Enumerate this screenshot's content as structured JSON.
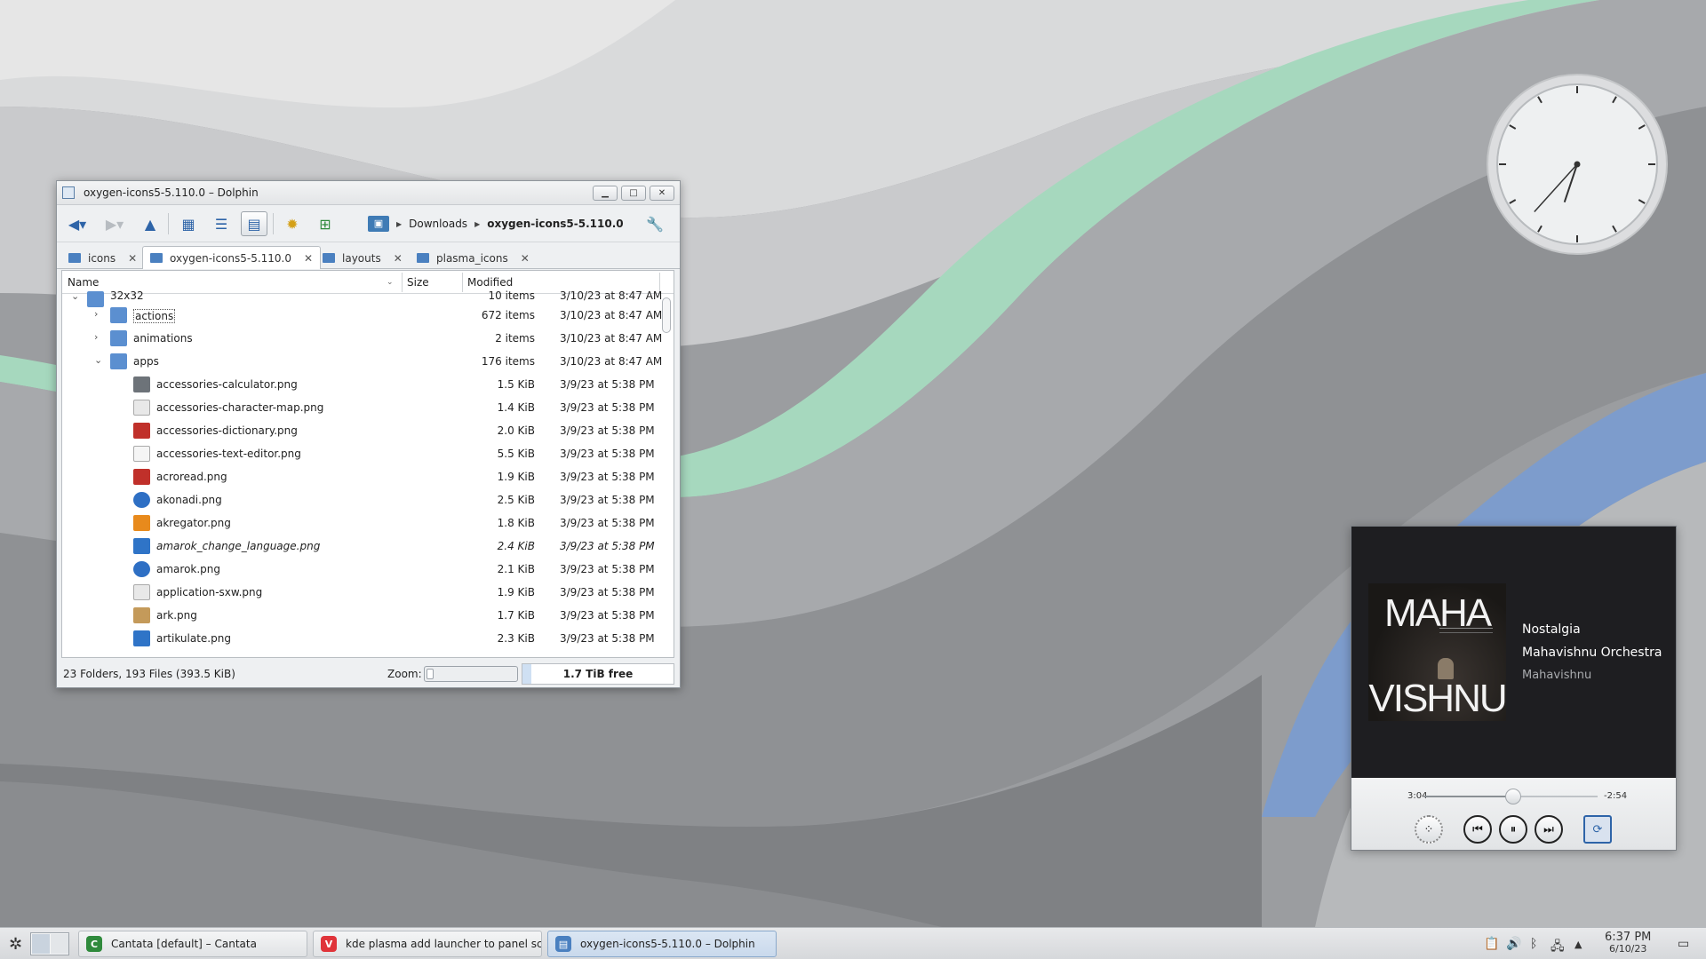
{
  "dolphin": {
    "title": "oxygen-icons5-5.110.0 – Dolphin",
    "breadcrumb": {
      "parent": "Downloads",
      "current": "oxygen-icons5-5.110.0"
    },
    "tabs": [
      {
        "label": "icons",
        "active": false
      },
      {
        "label": "oxygen-icons5-5.110.0",
        "active": true
      },
      {
        "label": "layouts",
        "active": false
      },
      {
        "label": "plasma_icons",
        "active": false
      }
    ],
    "columns": {
      "name": "Name",
      "size": "Size",
      "modified": "Modified"
    },
    "rows": [
      {
        "name": "32x32",
        "size": "10 items",
        "modified": "3/10/23 at 8:47 AM"
      },
      {
        "name": "actions",
        "size": "672 items",
        "modified": "3/10/23 at 8:47 AM"
      },
      {
        "name": "animations",
        "size": "2 items",
        "modified": "3/10/23 at 8:47 AM"
      },
      {
        "name": "apps",
        "size": "176 items",
        "modified": "3/10/23 at 8:47 AM"
      },
      {
        "name": "accessories-calculator.png",
        "size": "1.5 KiB",
        "modified": "3/9/23 at 5:38 PM"
      },
      {
        "name": "accessories-character-map.png",
        "size": "1.4 KiB",
        "modified": "3/9/23 at 5:38 PM"
      },
      {
        "name": "accessories-dictionary.png",
        "size": "2.0 KiB",
        "modified": "3/9/23 at 5:38 PM"
      },
      {
        "name": "accessories-text-editor.png",
        "size": "5.5 KiB",
        "modified": "3/9/23 at 5:38 PM"
      },
      {
        "name": "acroread.png",
        "size": "1.9 KiB",
        "modified": "3/9/23 at 5:38 PM"
      },
      {
        "name": "akonadi.png",
        "size": "2.5 KiB",
        "modified": "3/9/23 at 5:38 PM"
      },
      {
        "name": "akregator.png",
        "size": "1.8 KiB",
        "modified": "3/9/23 at 5:38 PM"
      },
      {
        "name": "amarok_change_language.png",
        "size": "2.4 KiB",
        "modified": "3/9/23 at 5:38 PM"
      },
      {
        "name": "amarok.png",
        "size": "2.1 KiB",
        "modified": "3/9/23 at 5:38 PM"
      },
      {
        "name": "application-sxw.png",
        "size": "1.9 KiB",
        "modified": "3/9/23 at 5:38 PM"
      },
      {
        "name": "ark.png",
        "size": "1.7 KiB",
        "modified": "3/9/23 at 5:38 PM"
      },
      {
        "name": "artikulate.png",
        "size": "2.3 KiB",
        "modified": "3/9/23 at 5:38 PM"
      }
    ],
    "status": {
      "info": "23 Folders, 193 Files (393.5 KiB)",
      "zoom_label": "Zoom:",
      "free_space": "1.7 TiB free"
    }
  },
  "player": {
    "album_art_text": [
      "MAHA",
      "VISHNU"
    ],
    "song": "Nostalgia",
    "artist": "Mahavishnu Orchestra",
    "album": "Mahavishnu",
    "elapsed": "3:04",
    "remaining": "-2:54",
    "progress": 0.514
  },
  "clock_widget": {
    "hour": 6,
    "minute": 37
  },
  "taskbar": {
    "tasks": [
      {
        "label": "Cantata [default] – Cantata",
        "icon": "cantata-icon",
        "color": "#2f8a3c"
      },
      {
        "label": "kde plasma add launcher to panel scripti...",
        "icon": "vivaldi-icon",
        "color": "#e0343a"
      },
      {
        "label": "oxygen-icons5-5.110.0 – Dolphin",
        "icon": "dolphin-icon",
        "color": "#4a80c0"
      }
    ],
    "time": "6:37 PM",
    "date": "6/10/23"
  },
  "colors": {
    "accent": "#4a80c0",
    "wall_green": "#a6d8be",
    "wall_blue": "#7d9ccc"
  }
}
